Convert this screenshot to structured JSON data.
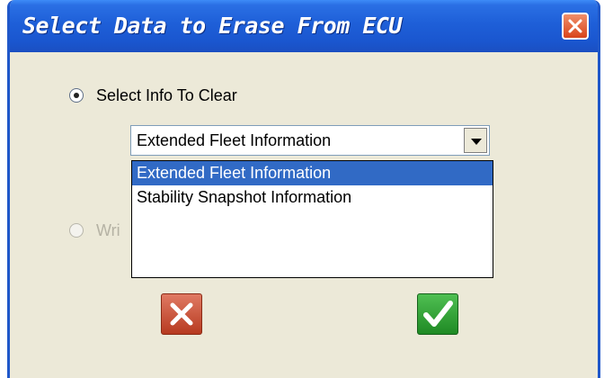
{
  "window": {
    "title": "Select Data to Erase From ECU",
    "close_icon": "close-icon"
  },
  "options": {
    "select_info_label": "Select Info To Clear",
    "select_info_selected": true,
    "second_option_label_visible": "Wri",
    "second_option_enabled": false
  },
  "combo": {
    "value": "Extended Fleet Information",
    "items": [
      {
        "label": "Extended Fleet Information",
        "selected": true
      },
      {
        "label": "Stability Snapshot Information",
        "selected": false
      }
    ]
  },
  "buttons": {
    "cancel_icon": "red-x-icon",
    "ok_icon": "green-checkmark-icon"
  },
  "colors": {
    "titlebar": "#1e5fd8",
    "window_bg": "#ece9d8",
    "selection": "#316ac5",
    "cancel": "#c9472a",
    "ok": "#2b9a2f"
  }
}
